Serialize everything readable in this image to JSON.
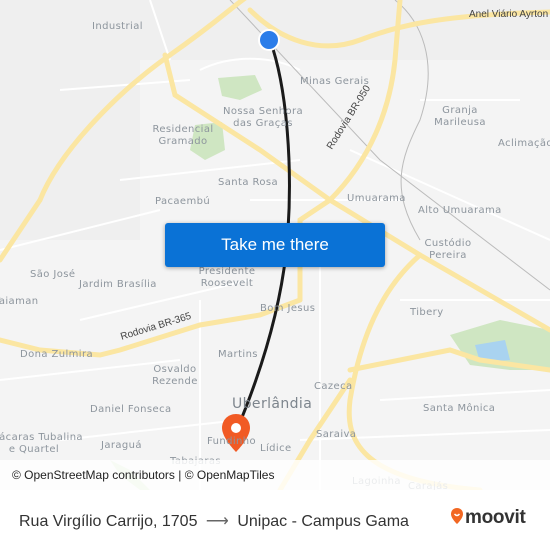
{
  "map": {
    "neighborhoods": [
      {
        "name": "Industrial"
      },
      {
        "name": "Minas Gerais"
      },
      {
        "name": "Nossa Senhora das Graças"
      },
      {
        "name": "Residencial Gramado"
      },
      {
        "name": "Granja Marileusa"
      },
      {
        "name": "Aclimação"
      },
      {
        "name": "Santa Rosa"
      },
      {
        "name": "Umuarama"
      },
      {
        "name": "Alto Umuarama"
      },
      {
        "name": "Pacaembú"
      },
      {
        "name": "Custódio Pereira"
      },
      {
        "name": "São José"
      },
      {
        "name": "Jardim Brasília"
      },
      {
        "name": "Presidente Roosevelt"
      },
      {
        "name": "Taiaman"
      },
      {
        "name": "Bom Jesus"
      },
      {
        "name": "Tibery"
      },
      {
        "name": "Dona Zulmira"
      },
      {
        "name": "Martins"
      },
      {
        "name": "Osvaldo Rezende"
      },
      {
        "name": "Cazeca"
      },
      {
        "name": "Daniel Fonseca"
      },
      {
        "name": "Santa Mônica"
      },
      {
        "name": "Chácaras Tubalina e Quartel"
      },
      {
        "name": "Jaraguá"
      },
      {
        "name": "Fundinho"
      },
      {
        "name": "Lídice"
      },
      {
        "name": "Saraiva"
      },
      {
        "name": "Tabajaras"
      },
      {
        "name": "Lagoinha"
      },
      {
        "name": "Carajás"
      }
    ],
    "city": "Uberlândia",
    "roads": {
      "anel": "Anel Viário Ayrton",
      "br050": "Rodovia BR-050",
      "br365": "Rodovia BR-365"
    },
    "origin_color": "#2b7de9",
    "destination_color": "#f15a24",
    "route_color": "#1a1a1a"
  },
  "cta": {
    "label": "Take me there",
    "color": "#0a72d6"
  },
  "attribution": "© OpenStreetMap contributors | © OpenMapTiles",
  "footer": {
    "origin": "Rua Virgílio Carrijo, 1705",
    "arrow": "⟶",
    "destination": "Unipac - Campus Gama",
    "brand": "moovit",
    "brand_color": "#f26722"
  }
}
